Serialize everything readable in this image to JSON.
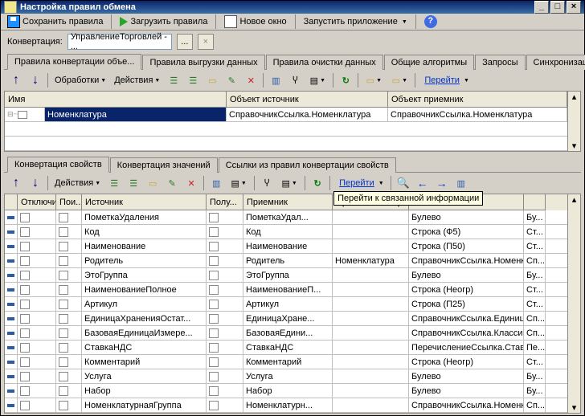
{
  "window": {
    "title": "Настройка правил обмена"
  },
  "topbar": {
    "save": "Сохранить правила",
    "load": "Загрузить правила",
    "newWindow": "Новое окно",
    "launch": "Запустить приложение",
    "helpGlyph": "?"
  },
  "conv": {
    "label": "Конвертация:",
    "value": "УправлениеТорговлей - ...",
    "btn": "...",
    "clr": "×"
  },
  "tabs1": [
    "Правила конвертации объе...",
    "Правила выгрузки данных",
    "Правила очистки данных",
    "Общие алгоритмы",
    "Запросы",
    "Синхронизация"
  ],
  "bar1": {
    "processing": "Обработки",
    "actions": "Действия",
    "goto": "Перейти"
  },
  "grid1": {
    "headers": [
      "Имя",
      "Объект источник",
      "Объект приемник"
    ],
    "row": {
      "name": "Номенклатура",
      "src": "СправочникСсылка.Номенклатура",
      "dst": "СправочникСсылка.Номенклатура"
    }
  },
  "tabs2": [
    "Конвертация свойств",
    "Конвертация значений",
    "Ссылки из правил конвертации свойств"
  ],
  "bar2": {
    "actions": "Действия",
    "goto": "Перейти"
  },
  "tooltip": "Перейти к связанной информации",
  "grid2": {
    "headers": [
      "",
      "Отключи...",
      "Пои...",
      "Источник",
      "Полу...",
      "Приемник",
      "Правило конверт...",
      "",
      ""
    ],
    "rows": [
      {
        "src": "ПометкаУдаления",
        "dst": "ПометкаУдал...",
        "rule": "",
        "t": "Булево",
        "e": "Бу..."
      },
      {
        "src": "Код",
        "dst": "Код",
        "rule": "",
        "t": "Строка (Ф5)",
        "e": "Ст..."
      },
      {
        "src": "Наименование",
        "dst": "Наименование",
        "rule": "",
        "t": "Строка (П50)",
        "e": "Ст..."
      },
      {
        "src": "Родитель",
        "dst": "Родитель",
        "rule": "Номенклатура",
        "t": "СправочникСсылка.Номенк...",
        "e": "Сп..."
      },
      {
        "src": "ЭтоГруппа",
        "dst": "ЭтоГруппа",
        "rule": "",
        "t": "Булево",
        "e": "Бу..."
      },
      {
        "src": "НаименованиеПолное",
        "dst": "НаименованиеП...",
        "rule": "",
        "t": "Строка (Неогр)",
        "e": "Ст..."
      },
      {
        "src": "Артикул",
        "dst": "Артикул",
        "rule": "",
        "t": "Строка (П25)",
        "e": "Ст..."
      },
      {
        "src": "ЕдиницаХраненияОстат...",
        "dst": "ЕдиницаХране...",
        "rule": "",
        "t": "СправочникСсылка.Единиц...",
        "e": "Сп..."
      },
      {
        "src": "БазоваяЕдиницаИзмере...",
        "dst": "БазоваяЕдини...",
        "rule": "",
        "t": "СправочникСсылка.Класси...",
        "e": "Сп..."
      },
      {
        "src": "СтавкаНДС",
        "dst": "СтавкаНДС",
        "rule": "",
        "t": "ПеречислениеСсылка.Став...",
        "e": "Пе..."
      },
      {
        "src": "Комментарий",
        "dst": "Комментарий",
        "rule": "",
        "t": "Строка (Неогр)",
        "e": "Ст..."
      },
      {
        "src": "Услуга",
        "dst": "Услуга",
        "rule": "",
        "t": "Булево",
        "e": "Бу..."
      },
      {
        "src": "Набор",
        "dst": "Набор",
        "rule": "",
        "t": "Булево",
        "e": "Бу..."
      },
      {
        "src": "НоменклатурнаяГруппа",
        "dst": "Номенклатурн...",
        "rule": "",
        "t": "СправочникСсылка.Номенк...",
        "e": "Сп..."
      }
    ]
  }
}
